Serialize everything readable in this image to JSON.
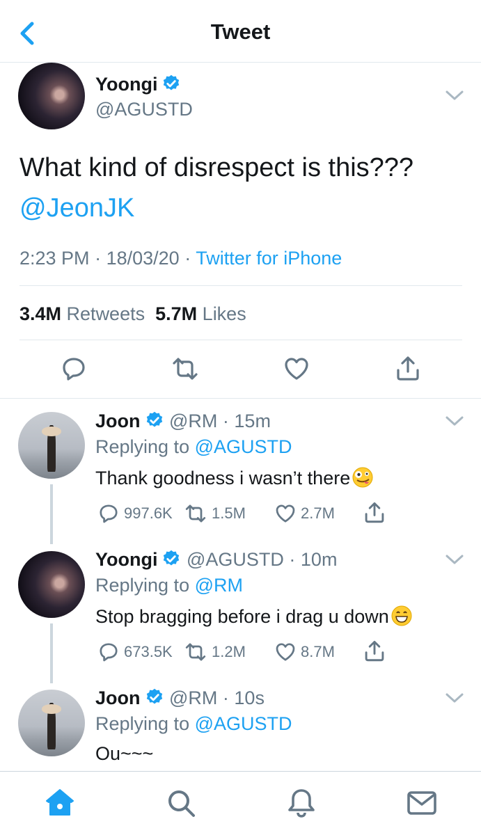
{
  "header": {
    "title": "Tweet",
    "back_icon": "chevron-left-icon"
  },
  "main_tweet": {
    "name": "Yoongi",
    "handle": "@AGUSTD",
    "text_line1": "What kind of disrespect is this???",
    "text_mention": "@JeonJK",
    "time": "2:23 PM",
    "dot1": "·",
    "date": "18/03/20",
    "dot2": "·",
    "source": "Twitter for iPhone",
    "retweets_count": "3.4M",
    "retweets_label": "Retweets",
    "likes_count": "5.7M",
    "likes_label": "Likes"
  },
  "replies": [
    {
      "name": "Joon",
      "handle_time": "@RM · 15m",
      "replying_label": "Replying to",
      "replying_to": "@AGUSTD",
      "text": "Thank goodness i wasn’t there",
      "emoji": "zany-face",
      "replies": "997.6K",
      "retweets": "1.5M",
      "likes": "2.7M"
    },
    {
      "name": "Yoongi",
      "handle_time": "@AGUSTD · 10m",
      "replying_label": "Replying to",
      "replying_to": "@RM",
      "text": "Stop bragging before i drag u down",
      "emoji": "grinning-face",
      "replies": "673.5K",
      "retweets": "1.2M",
      "likes": "8.7M"
    },
    {
      "name": "Joon",
      "handle_time": "@RM · 10s",
      "replying_label": "Replying to",
      "replying_to": "@AGUSTD",
      "text": "Ou~~~"
    }
  ],
  "tabbar": [
    "home-icon",
    "search-icon",
    "notifications-icon",
    "messages-icon"
  ],
  "colors": {
    "accent": "#1da1f2",
    "text": "#14171a",
    "secondary": "#657786",
    "border": "#e1e8ed"
  }
}
